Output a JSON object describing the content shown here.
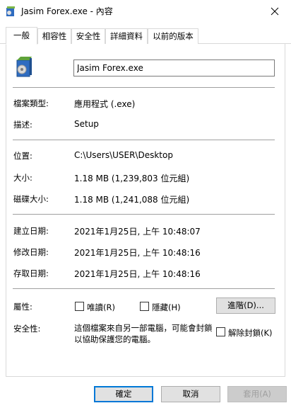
{
  "window": {
    "title": "Jasim Forex.exe - 內容",
    "close_icon": "close-icon"
  },
  "tabs": [
    {
      "label": "一般"
    },
    {
      "label": "相容性"
    },
    {
      "label": "安全性"
    },
    {
      "label": "詳細資料"
    },
    {
      "label": "以前的版本"
    }
  ],
  "general": {
    "file_name": "Jasim Forex.exe",
    "file_type_label": "檔案類型:",
    "file_type_value": "應用程式 (.exe)",
    "description_label": "描述:",
    "description_value": "Setup",
    "location_label": "位置:",
    "location_value": "C:\\Users\\USER\\Desktop",
    "size_label": "大小:",
    "size_value": "1.18 MB (1,239,803 位元組)",
    "size_on_disk_label": "磁碟大小:",
    "size_on_disk_value": "1.18 MB (1,241,088 位元組)",
    "created_label": "建立日期:",
    "created_value": "2021年1月25日, 上午 10:48:07",
    "modified_label": "修改日期:",
    "modified_value": "2021年1月25日, 上午 10:48:16",
    "accessed_label": "存取日期:",
    "accessed_value": "2021年1月25日, 上午 10:48:16",
    "attributes_label": "屬性:",
    "readonly_label": "唯讀(R)",
    "hidden_label": "隱藏(H)",
    "advanced_label": "進階(D)...",
    "security_label": "安全性:",
    "security_text": "這個檔案來自另一部電腦，可能會封鎖以協助保護您的電腦。",
    "unblock_label": "解除封鎖(K)"
  },
  "buttons": {
    "ok": "確定",
    "cancel": "取消",
    "apply": "套用(A)"
  },
  "colors": {
    "accent": "#0078d7"
  }
}
